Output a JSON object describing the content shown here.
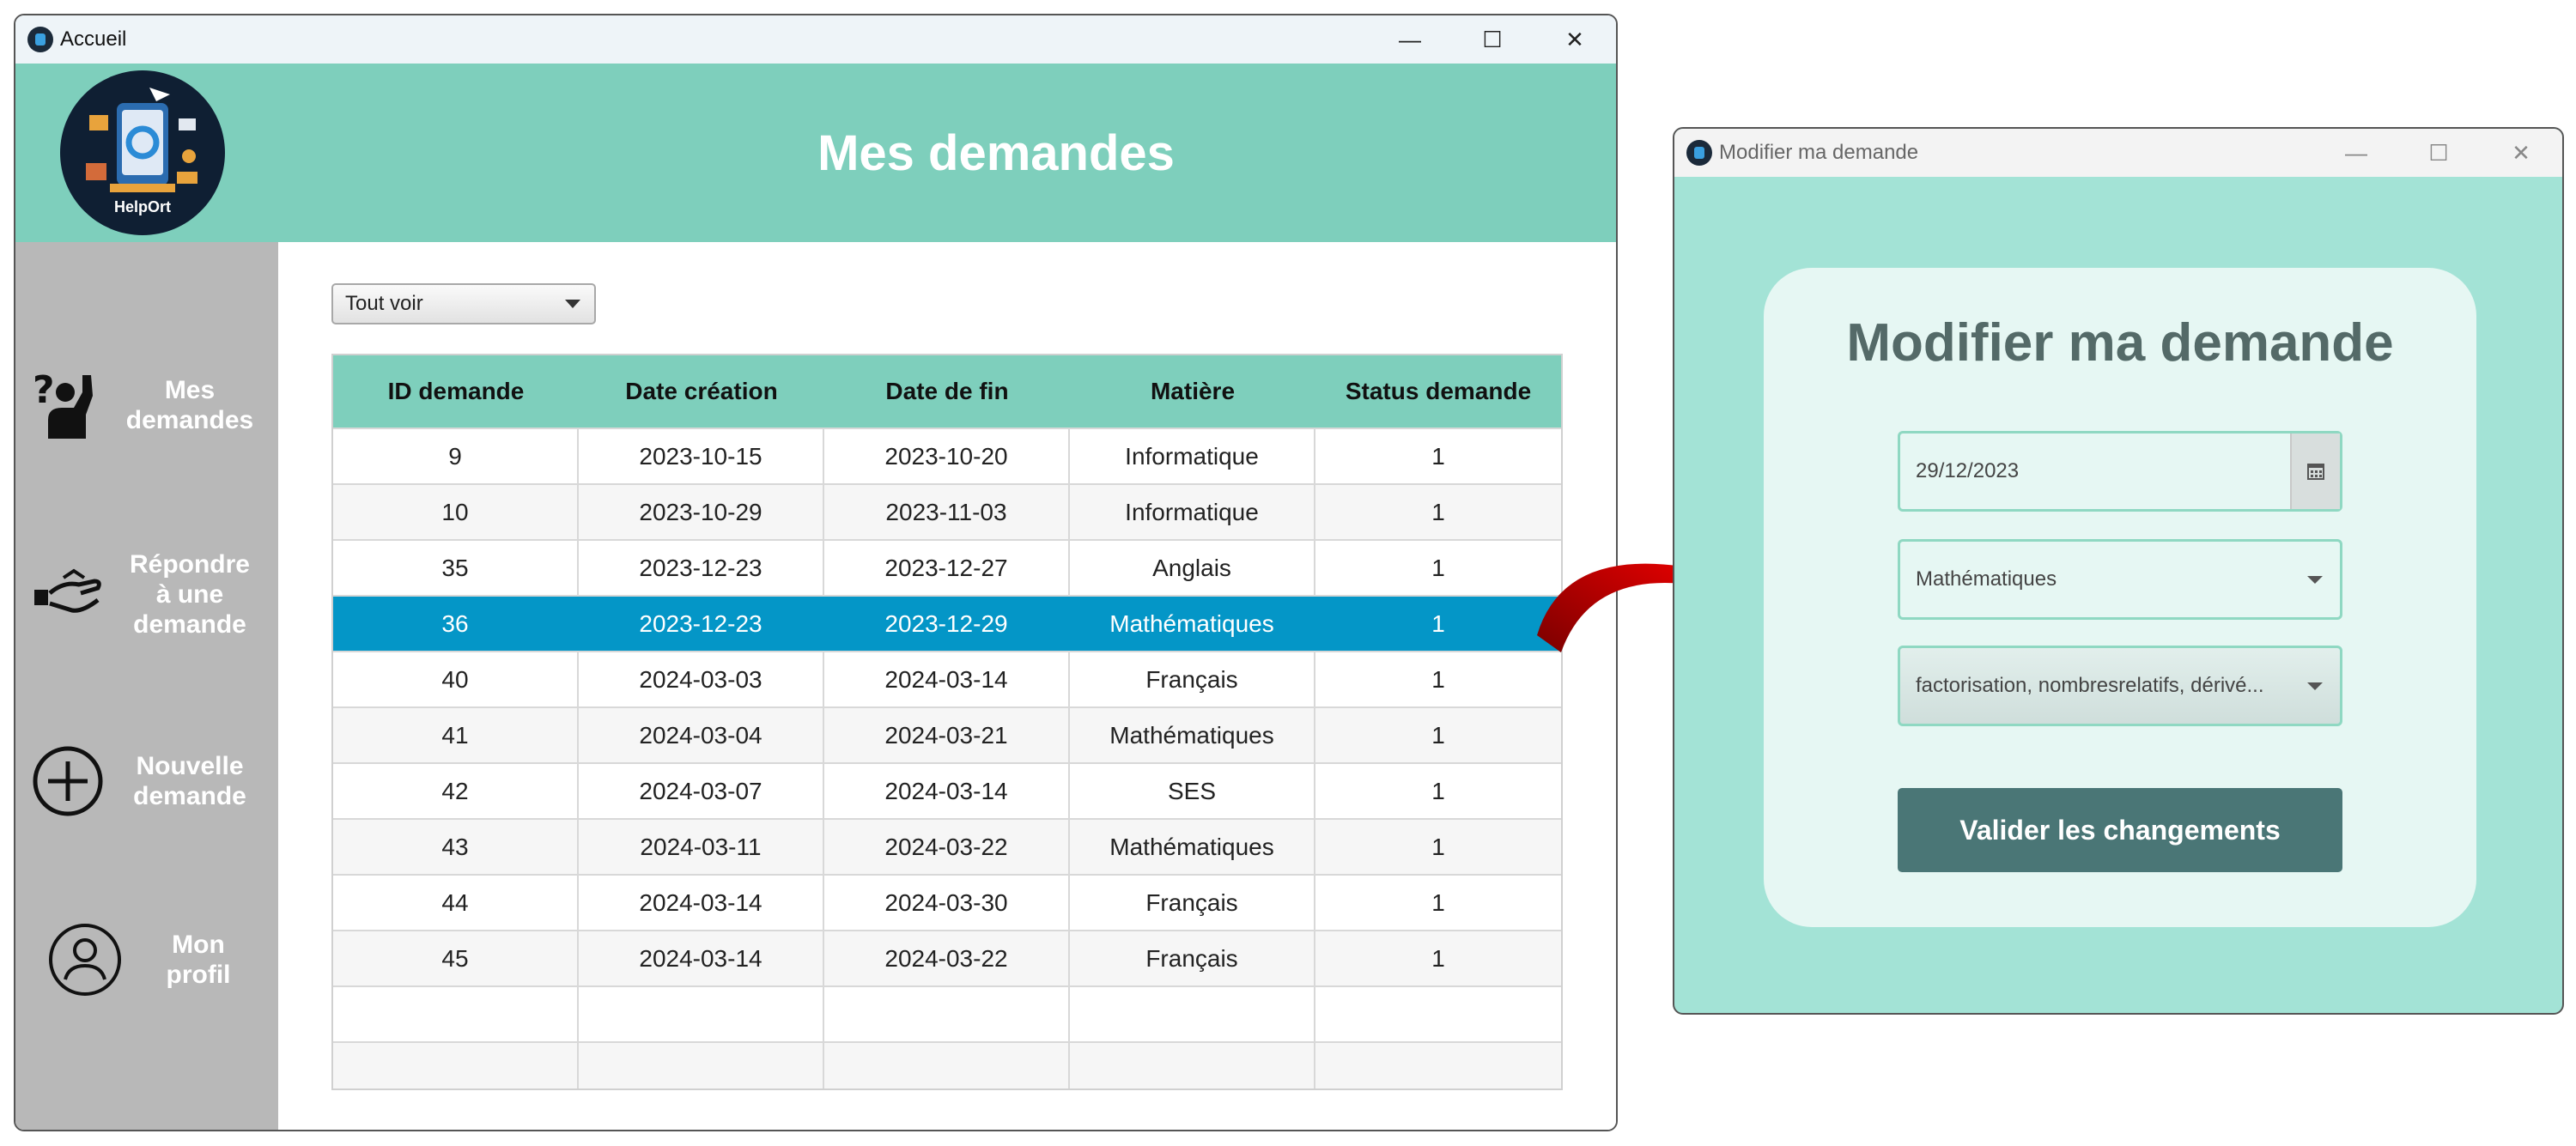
{
  "main_window": {
    "title": "Accueil",
    "controls": {
      "minimize": "—",
      "maximize": "☐",
      "close": "✕"
    },
    "header": {
      "title": "Mes demandes",
      "logo_text": "HelpOrt"
    },
    "sidebar": {
      "items": [
        {
          "label": "Mes\ndemandes",
          "icon": "raised-hand-question-icon"
        },
        {
          "label": "Répondre\nà une\ndemande",
          "icon": "helping-hands-icon"
        },
        {
          "label": "Nouvelle\ndemande",
          "icon": "plus-circle-icon"
        },
        {
          "label": "Mon\nprofil",
          "icon": "user-circle-icon"
        }
      ]
    },
    "filter": {
      "selected": "Tout voir"
    },
    "table": {
      "columns": [
        "ID demande",
        "Date création",
        "Date de fin",
        "Matière",
        "Status demande"
      ],
      "rows": [
        [
          "9",
          "2023-10-15",
          "2023-10-20",
          "Informatique",
          "1"
        ],
        [
          "10",
          "2023-10-29",
          "2023-11-03",
          "Informatique",
          "1"
        ],
        [
          "35",
          "2023-12-23",
          "2023-12-27",
          "Anglais",
          "1"
        ],
        [
          "36",
          "2023-12-23",
          "2023-12-29",
          "Mathématiques",
          "1"
        ],
        [
          "40",
          "2024-03-03",
          "2024-03-14",
          "Français",
          "1"
        ],
        [
          "41",
          "2024-03-04",
          "2024-03-21",
          "Mathématiques",
          "1"
        ],
        [
          "42",
          "2024-03-07",
          "2024-03-14",
          "SES",
          "1"
        ],
        [
          "43",
          "2024-03-11",
          "2024-03-22",
          "Mathématiques",
          "1"
        ],
        [
          "44",
          "2024-03-14",
          "2024-03-30",
          "Français",
          "1"
        ],
        [
          "45",
          "2024-03-14",
          "2024-03-22",
          "Français",
          "1"
        ]
      ],
      "selected_row_index": 3
    }
  },
  "edit_window": {
    "title": "Modifier ma demande",
    "controls": {
      "minimize": "—",
      "maximize": "☐",
      "close": "✕"
    },
    "heading": "Modifier ma demande",
    "date_value": "29/12/2023",
    "subject_value": "Mathématiques",
    "topics_value": "factorisation, nombresrelatifs, dérivé...",
    "submit_label": "Valider les changements"
  },
  "colors": {
    "header": "#7ecfbc",
    "sidebar": "#b8b8b8",
    "selected_row": "#0496c7",
    "edit_background": "#a3e3d6",
    "card": "#e6f7f3",
    "button": "#4a7676",
    "arrow": "#c40000"
  }
}
